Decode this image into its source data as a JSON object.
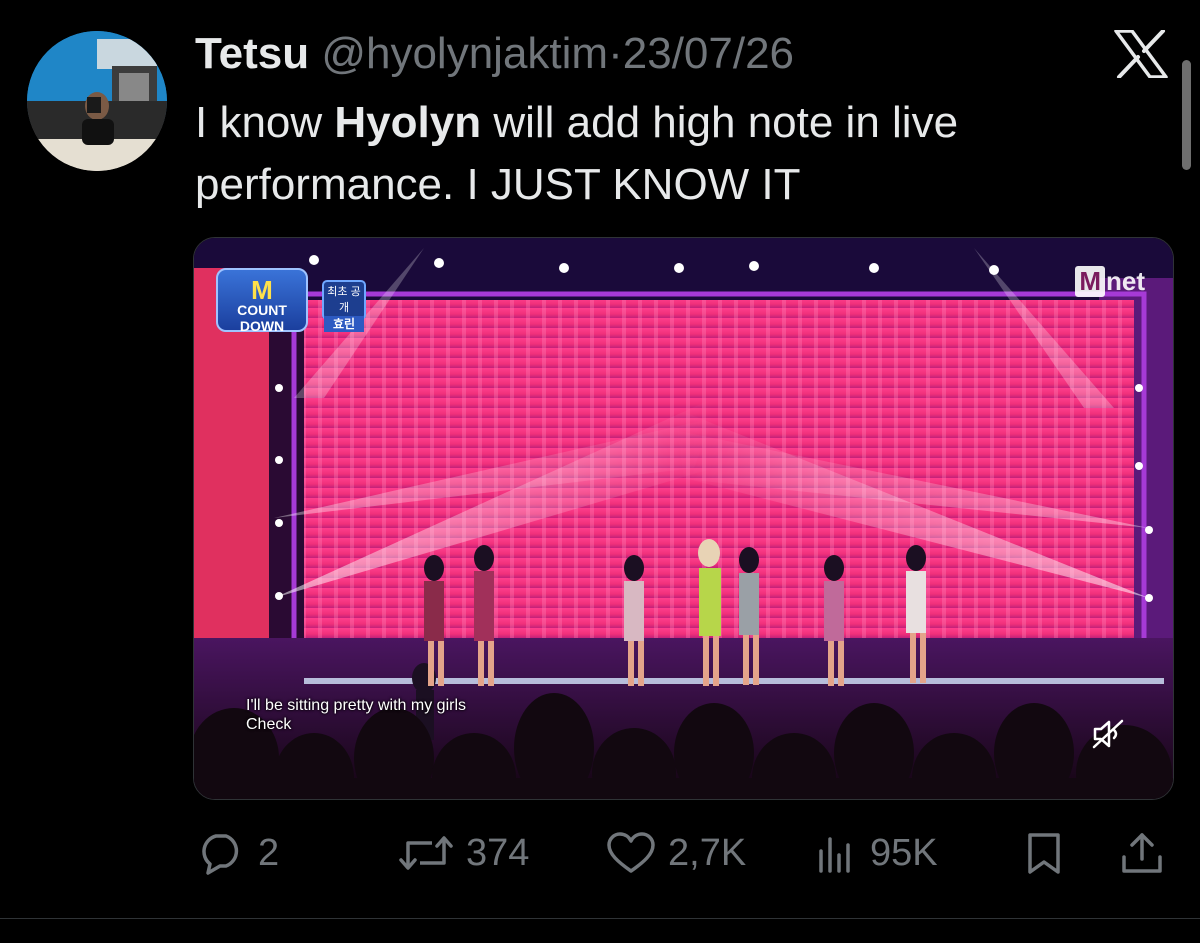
{
  "tweet": {
    "author": {
      "display_name": "Tetsu",
      "handle": "@hyolynjaktim",
      "date": "23/07/26",
      "separator": "·"
    },
    "text_before": "I know ",
    "text_bold": "Hyolyn",
    "text_after": " will add high note in live performance. I JUST KNOW IT"
  },
  "media": {
    "program_badge": {
      "logo": "M",
      "line1": "COUNT",
      "line2": "DOWN"
    },
    "korean_badge": {
      "top": "최초 공개",
      "name": "효린"
    },
    "channel_logo": {
      "box": "M",
      "rest": "net"
    },
    "subtitles": [
      "I'll be sitting pretty with my girls",
      "Check"
    ],
    "muted": true,
    "mute_icon": "speaker-muted-icon"
  },
  "actions": {
    "reply": {
      "count": "2",
      "icon": "reply-bubble-icon"
    },
    "repost": {
      "count": "374",
      "icon": "repost-icon"
    },
    "like": {
      "count": "2,7K",
      "icon": "heart-icon"
    },
    "views": {
      "count": "95K",
      "icon": "bar-chart-icon"
    },
    "bookmark": {
      "icon": "bookmark-icon"
    },
    "share": {
      "icon": "share-icon"
    }
  },
  "colors": {
    "background": "#000000",
    "text_primary": "#e7e9ea",
    "text_secondary": "#71767b",
    "divider": "#2f3336"
  }
}
